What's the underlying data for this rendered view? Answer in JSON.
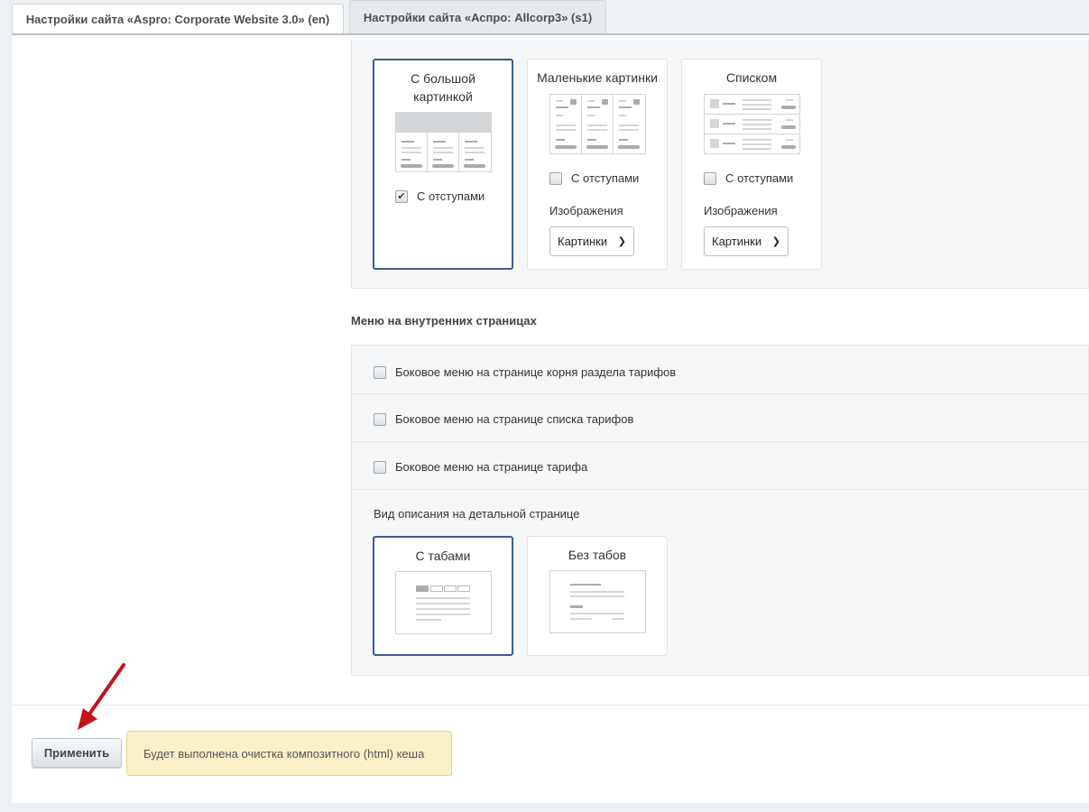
{
  "tabs": [
    {
      "label": "Настройки сайта «Aspro: Corporate Website 3.0» (en)"
    },
    {
      "label": "Настройки сайта «Аспро: Allcorp3» (s1)"
    }
  ],
  "view_cards": [
    {
      "title": "С большой картинкой",
      "checkbox_label": "С отступами",
      "checked": true,
      "selected": true
    },
    {
      "title": "Маленькие картинки",
      "checkbox_label": "С отступами",
      "checked": false,
      "images_label": "Изображения",
      "select_value": "Картинки"
    },
    {
      "title": "Списком",
      "checkbox_label": "С отступами",
      "checked": false,
      "images_label": "Изображения",
      "select_value": "Картинки"
    }
  ],
  "inner_menu": {
    "title": "Меню на внутренних страницах",
    "options": [
      {
        "label": "Боковое меню на странице корня раздела тарифов",
        "checked": false
      },
      {
        "label": "Боковое меню на странице списка тарифов",
        "checked": false
      },
      {
        "label": "Боковое меню на странице тарифа",
        "checked": false
      }
    ],
    "detail_label": "Вид описания на детальной странице",
    "detail_cards": [
      {
        "title": "С табами",
        "selected": true
      },
      {
        "title": "Без табов",
        "selected": false
      }
    ]
  },
  "footer": {
    "apply_label": "Применить",
    "note": "Будет выполнена очистка композитного (html) кеша"
  },
  "colors": {
    "accent": "#3a5a9a",
    "note_bg": "#f8f1c8",
    "arrow": "#c0141b"
  }
}
